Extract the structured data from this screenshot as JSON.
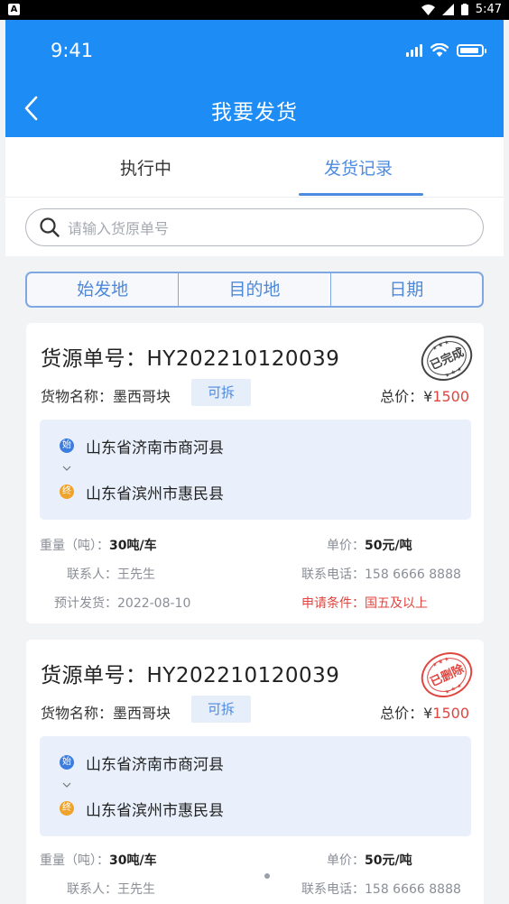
{
  "android_status": {
    "time": "5:47"
  },
  "ios_status": {
    "time": "9:41"
  },
  "header": {
    "title": "我要发货"
  },
  "tabs": [
    {
      "label": "执行中"
    },
    {
      "label": "发货记录"
    }
  ],
  "search": {
    "placeholder": "请输入货原单号"
  },
  "filters": [
    {
      "label": "始发地"
    },
    {
      "label": "目的地"
    },
    {
      "label": "日期"
    }
  ],
  "cards": [
    {
      "title": "货源单号：HY202210120039",
      "stamp": "已完成",
      "goods_label": "货物名称：",
      "goods_value": "墨西哥块",
      "tag": "可拆",
      "price_label": "总价：",
      "price_symbol": "¥",
      "price_value": "1500",
      "route_from_badge": "始",
      "route_from": "山东省济南市商河县",
      "route_to_badge": "终",
      "route_to": "山东省滨州市惠民县",
      "weight_label": "重量（吨）：",
      "weight_value": "30吨/车",
      "unit_price_label": "单价：",
      "unit_price_value": "50元/吨",
      "contact_label": "联系人：",
      "contact_value": "王先生",
      "phone_label": "联系电话：",
      "phone_value": "158 6666 8888",
      "ship_label": "预计发货：",
      "ship_value": "2022-08-10",
      "condition_label": "申请条件：",
      "condition_value": "国五及以上"
    },
    {
      "title": "货源单号：HY202210120039",
      "stamp": "已删除",
      "goods_label": "货物名称：",
      "goods_value": "墨西哥块",
      "tag": "可拆",
      "price_label": "总价：",
      "price_symbol": "¥",
      "price_value": "1500",
      "route_from_badge": "始",
      "route_from": "山东省济南市商河县",
      "route_to_badge": "终",
      "route_to": "山东省滨州市惠民县",
      "weight_label": "重量（吨）：",
      "weight_value": "30吨/车",
      "unit_price_label": "单价：",
      "unit_price_value": "50元/吨",
      "contact_label": "联系人：",
      "contact_value": "王先生",
      "phone_label": "联系电话：",
      "phone_value": "158 6666 8888"
    }
  ],
  "colors": {
    "primary": "#1e8cf5",
    "accent": "#4d8be0",
    "price_red": "#e0453f",
    "stamp_gray": "#444444",
    "stamp_red": "#e0453f"
  },
  "icons": [
    "back-chevron-icon",
    "search-icon",
    "wifi-icon",
    "battery-icon",
    "signal-icon"
  ]
}
